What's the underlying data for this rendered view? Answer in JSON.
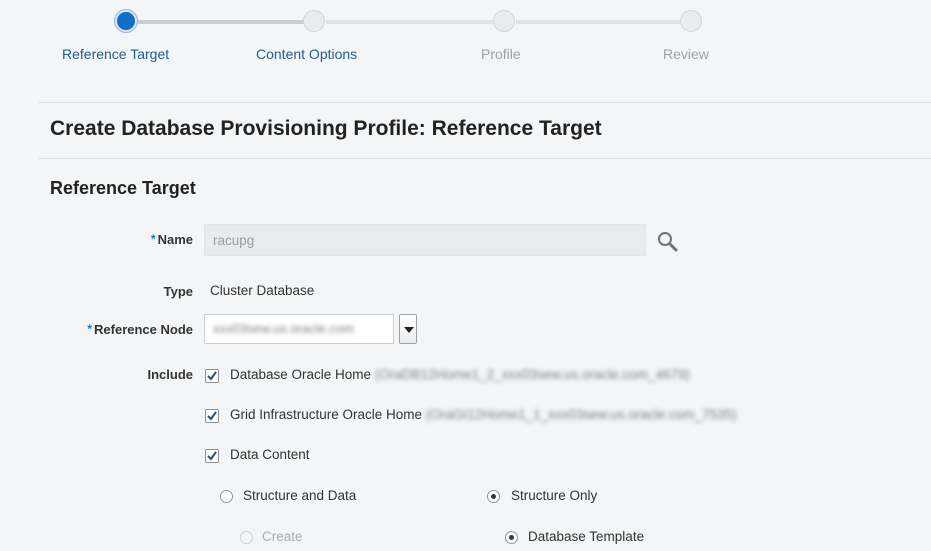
{
  "train": {
    "steps": [
      {
        "label": "Reference Target",
        "state": "current"
      },
      {
        "label": "Content Options",
        "state": "next"
      },
      {
        "label": "Profile",
        "state": "disabled"
      },
      {
        "label": "Review",
        "state": "disabled"
      }
    ]
  },
  "page_title": "Create Database Provisioning Profile: Reference Target",
  "section_title": "Reference Target",
  "form": {
    "required_marker": "*",
    "name": {
      "label": "Name",
      "value": "racupg"
    },
    "type": {
      "label": "Type",
      "value": "Cluster Database"
    },
    "reference_node": {
      "label": "Reference Node",
      "value": "xxx03sew.us.oracle.com"
    },
    "include": {
      "label": "Include",
      "options": [
        {
          "label": "Database Oracle Home",
          "detail": "(OraDB12Home1_2_xxx03sew.us.oracle.com_4679)",
          "checked": true
        },
        {
          "label": "Grid Infrastructure Oracle Home",
          "detail": "(OraGI12Home1_1_xxx03sew.us.oracle.com_7535)",
          "checked": true
        },
        {
          "label": "Data Content",
          "detail": "",
          "checked": true
        }
      ]
    },
    "data_mode": {
      "left": {
        "label": "Structure and Data",
        "selected": false
      },
      "right": {
        "label": "Structure Only",
        "selected": true
      }
    },
    "structure_method": {
      "left": {
        "label": "Create",
        "selected": false,
        "disabled": true
      },
      "right": {
        "label": "Database Template",
        "selected": true
      }
    }
  },
  "colors": {
    "accent": "#0f6fc6",
    "link": "#1f5d93",
    "background": "#f3f5f6"
  }
}
